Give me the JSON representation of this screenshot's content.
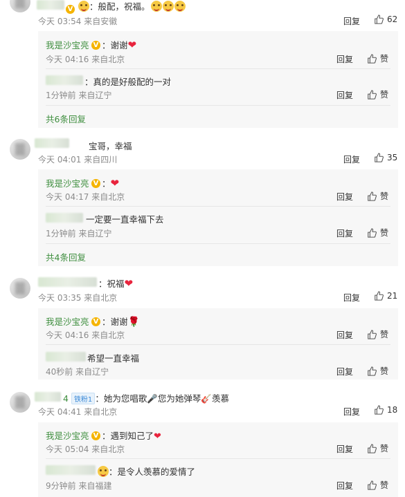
{
  "labels": {
    "reply": "回复",
    "like_text": "赞"
  },
  "colors": {
    "author_name": "#3e8e3e",
    "more_link": "#3e8e3e",
    "meta": "#8b8b8b",
    "heart": "#e8243d"
  },
  "icons": {
    "like": "thumbs-up-icon",
    "verified": "verified-v-icon",
    "heart": "heart-icon",
    "rose": "rose-icon",
    "mic": "microphone-icon",
    "guitar": "guitar-icon",
    "emoji": "smiling-face-icon"
  },
  "comments": [
    {
      "text": "：般配，祝福。",
      "meta": "今天 03:54 来自安徽",
      "likes": "62",
      "replies": [
        {
          "name": "我是沙宝亮",
          "text": "：谢谢",
          "meta": "今天 04:16 来自北京"
        },
        {
          "name": "",
          "text": "：真的是好般配的一对",
          "meta": "1分钟前 来自辽宁"
        }
      ],
      "more": "共6条回复"
    },
    {
      "text": "宝哥，幸福",
      "meta": "今天 04:01 来自四川",
      "likes": "35",
      "replies": [
        {
          "name": "我是沙宝亮",
          "text": "：",
          "meta": "今天 04:17 来自北京"
        },
        {
          "name": "",
          "text": "一定要一直幸福下去",
          "meta": "1分钟前 来自辽宁"
        }
      ],
      "more": "共4条回复"
    },
    {
      "text": "：祝福",
      "meta": "今天 03:35 来自北京",
      "likes": "21",
      "replies": [
        {
          "name": "我是沙宝亮",
          "text": "：谢谢",
          "meta": "今天 04:16 来自北京"
        },
        {
          "name": "",
          "text": "希望一直幸福",
          "meta": "40秒前 来自辽宁"
        }
      ]
    },
    {
      "name_suffix": "4",
      "badge": "铁粉1",
      "text_a": "：她为您唱歌",
      "text_b": "您为她弹琴",
      "text_c": "羡慕",
      "meta": "今天 04:41 来自北京",
      "likes": "18",
      "replies": [
        {
          "name": "我是沙宝亮",
          "text": "：遇到知己了",
          "meta": "今天 05:04 来自北京"
        },
        {
          "name": "",
          "text": "：是令人羡慕的爱情了",
          "meta": "9分钟前 来自福建"
        }
      ]
    }
  ]
}
